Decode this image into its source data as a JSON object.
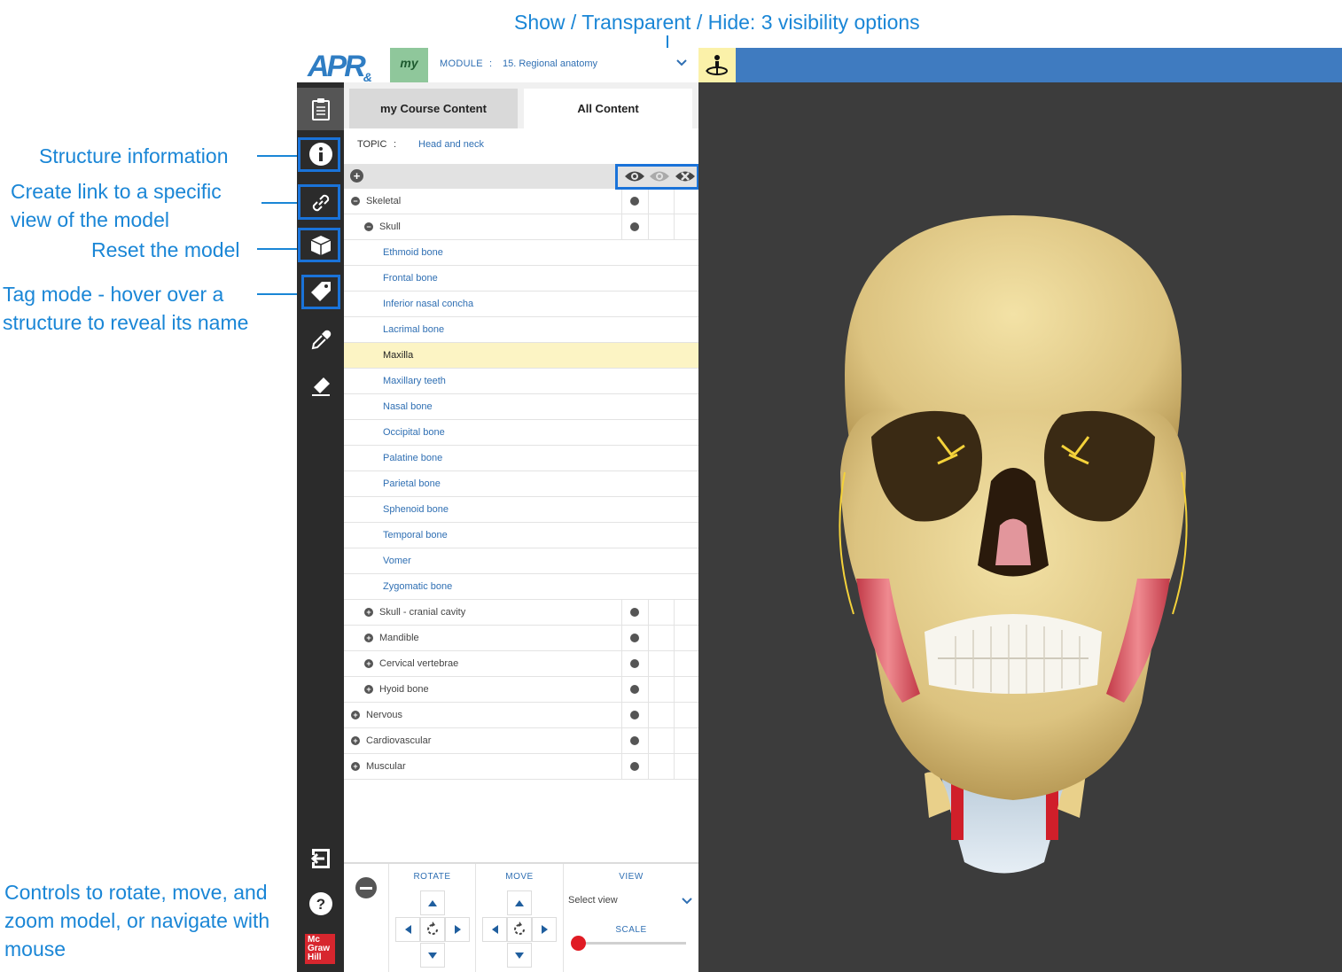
{
  "annotations": {
    "visibility": "Show / Transparent / Hide: 3 visibility options",
    "structure_info": "Structure information",
    "create_link_1": "Create link to a specific",
    "create_link_2": "view of the model",
    "reset": "Reset the model",
    "tag_1": "Tag mode - hover over a",
    "tag_2": "structure to reveal its name",
    "controls_1": "Controls to rotate, move, and",
    "controls_2": "zoom model, or navigate with",
    "controls_3": "mouse"
  },
  "header": {
    "logo_text": "APR",
    "logo_amp": "&",
    "my_badge": "my",
    "module_label": "MODULE",
    "module_colon": ":",
    "module_value": "15. Regional anatomy",
    "topbar_color": "#3f7bc0"
  },
  "sidebar": {
    "items": [
      "clipboard-icon",
      "info-icon",
      "link-icon",
      "cube-icon",
      "tag-icon",
      "dropper-icon",
      "eraser-icon"
    ],
    "bottom": [
      "exit-icon",
      "help-icon"
    ],
    "brand_lines": [
      "Mc",
      "Graw",
      "Hill"
    ]
  },
  "panel": {
    "tabs": [
      {
        "label": "my Course Content",
        "active": false
      },
      {
        "label": "All Content",
        "active": true
      }
    ],
    "topic_label": "TOPIC",
    "topic_colon": ":",
    "topic_value": "Head and neck",
    "tree": [
      {
        "label": "Skeletal",
        "level": 0,
        "toggle": "minus",
        "dot": true
      },
      {
        "label": "Skull",
        "level": 1,
        "toggle": "minus",
        "dot": true
      },
      {
        "label": "Ethmoid bone",
        "level": 2
      },
      {
        "label": "Frontal bone",
        "level": 2
      },
      {
        "label": "Inferior nasal concha",
        "level": 2
      },
      {
        "label": "Lacrimal bone",
        "level": 2
      },
      {
        "label": "Maxilla",
        "level": 2,
        "selected": true
      },
      {
        "label": "Maxillary teeth",
        "level": 2
      },
      {
        "label": "Nasal bone",
        "level": 2
      },
      {
        "label": "Occipital bone",
        "level": 2
      },
      {
        "label": "Palatine bone",
        "level": 2
      },
      {
        "label": "Parietal bone",
        "level": 2
      },
      {
        "label": "Sphenoid bone",
        "level": 2
      },
      {
        "label": "Temporal bone",
        "level": 2
      },
      {
        "label": "Vomer",
        "level": 2
      },
      {
        "label": "Zygomatic bone",
        "level": 2
      },
      {
        "label": "Skull - cranial cavity",
        "level": 1,
        "toggle": "plus",
        "dot": true
      },
      {
        "label": "Mandible",
        "level": 1,
        "toggle": "plus",
        "dot": true
      },
      {
        "label": "Cervical vertebrae",
        "level": 1,
        "toggle": "plus",
        "dot": true
      },
      {
        "label": "Hyoid bone",
        "level": 1,
        "toggle": "plus",
        "dot": true
      },
      {
        "label": "Nervous",
        "level": 0,
        "toggle": "plus",
        "dot": true
      },
      {
        "label": "Cardiovascular",
        "level": 0,
        "toggle": "plus",
        "dot": true
      },
      {
        "label": "Muscular",
        "level": 0,
        "toggle": "plus",
        "dot": true
      }
    ]
  },
  "controls": {
    "rotate_label": "ROTATE",
    "move_label": "MOVE",
    "view_label": "VIEW",
    "view_select": "Select view",
    "scale_label": "SCALE",
    "scale_value": 0
  },
  "colors": {
    "accent": "#1a86d6",
    "viewer_bg": "#3c3c3c",
    "selected_row": "#fcf4c4",
    "slider_thumb": "#e01b24"
  }
}
